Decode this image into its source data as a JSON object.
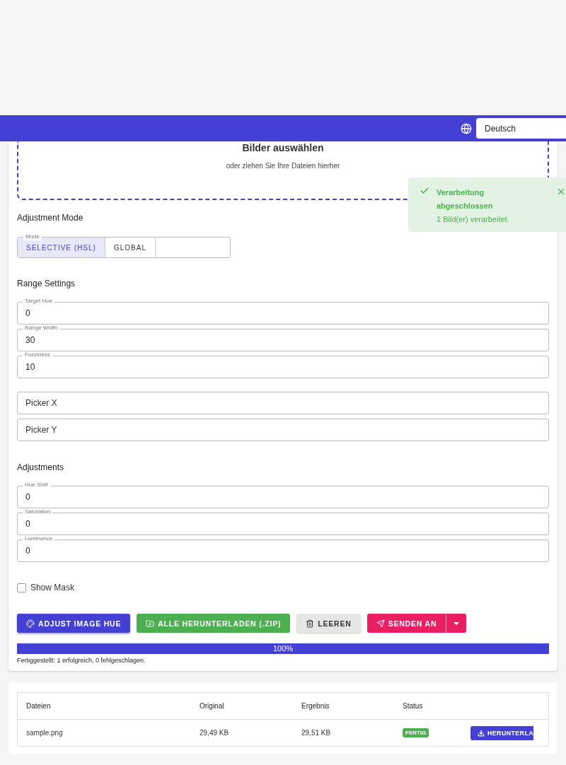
{
  "header": {
    "language": "Deutsch"
  },
  "dropzone": {
    "title": "Bilder auswählen",
    "subtitle": "oder ziehen Sie Ihre Dateien hierher"
  },
  "toast": {
    "title": "Verarbeitung abgeschlossen",
    "message": "1 Bild(er) verarbeitet."
  },
  "adjustment_mode": {
    "heading": "Adjustment Mode",
    "label": "Mode",
    "options": [
      {
        "label": "SELECTIVE (HSL)",
        "selected": true
      },
      {
        "label": "GLOBAL",
        "selected": false
      }
    ]
  },
  "range_settings": {
    "heading": "Range Settings",
    "fields": [
      {
        "label": "Target Hue",
        "value": "0"
      },
      {
        "label": "Range Width",
        "value": "30"
      },
      {
        "label": "Fuzziness",
        "value": "10"
      }
    ]
  },
  "picker_fields": [
    {
      "placeholder": "Picker X"
    },
    {
      "placeholder": "Picker Y"
    }
  ],
  "adjustments": {
    "heading": "Adjustments",
    "fields": [
      {
        "label": "Hue Shift",
        "value": "0"
      },
      {
        "label": "Saturation",
        "value": "0"
      },
      {
        "label": "Luminance",
        "value": "0"
      }
    ]
  },
  "show_mask": {
    "label": "Show Mask",
    "checked": false
  },
  "actions": [
    {
      "kind": "primary",
      "label": "ADJUST IMAGE HUE"
    },
    {
      "kind": "success",
      "label": "ALLE HERUNTERLADEN (.ZIP)"
    },
    {
      "kind": "neutral",
      "label": "LEEREN"
    },
    {
      "kind": "split",
      "label": "SENDEN AN"
    }
  ],
  "progress": {
    "level": 1,
    "reading": "100%",
    "summary": "Fertiggestellt: 1 erfolgreich, 0 fehlgeschlagen."
  },
  "files_table": {
    "columns": [
      "Dateien",
      "Original",
      "Ergebnis",
      "Status"
    ],
    "rows": [
      {
        "file": "sample.png",
        "original": "29,49 KB",
        "result": "29,51 KB",
        "status": "FERTIG",
        "action": "HERUNTERLA"
      }
    ]
  }
}
